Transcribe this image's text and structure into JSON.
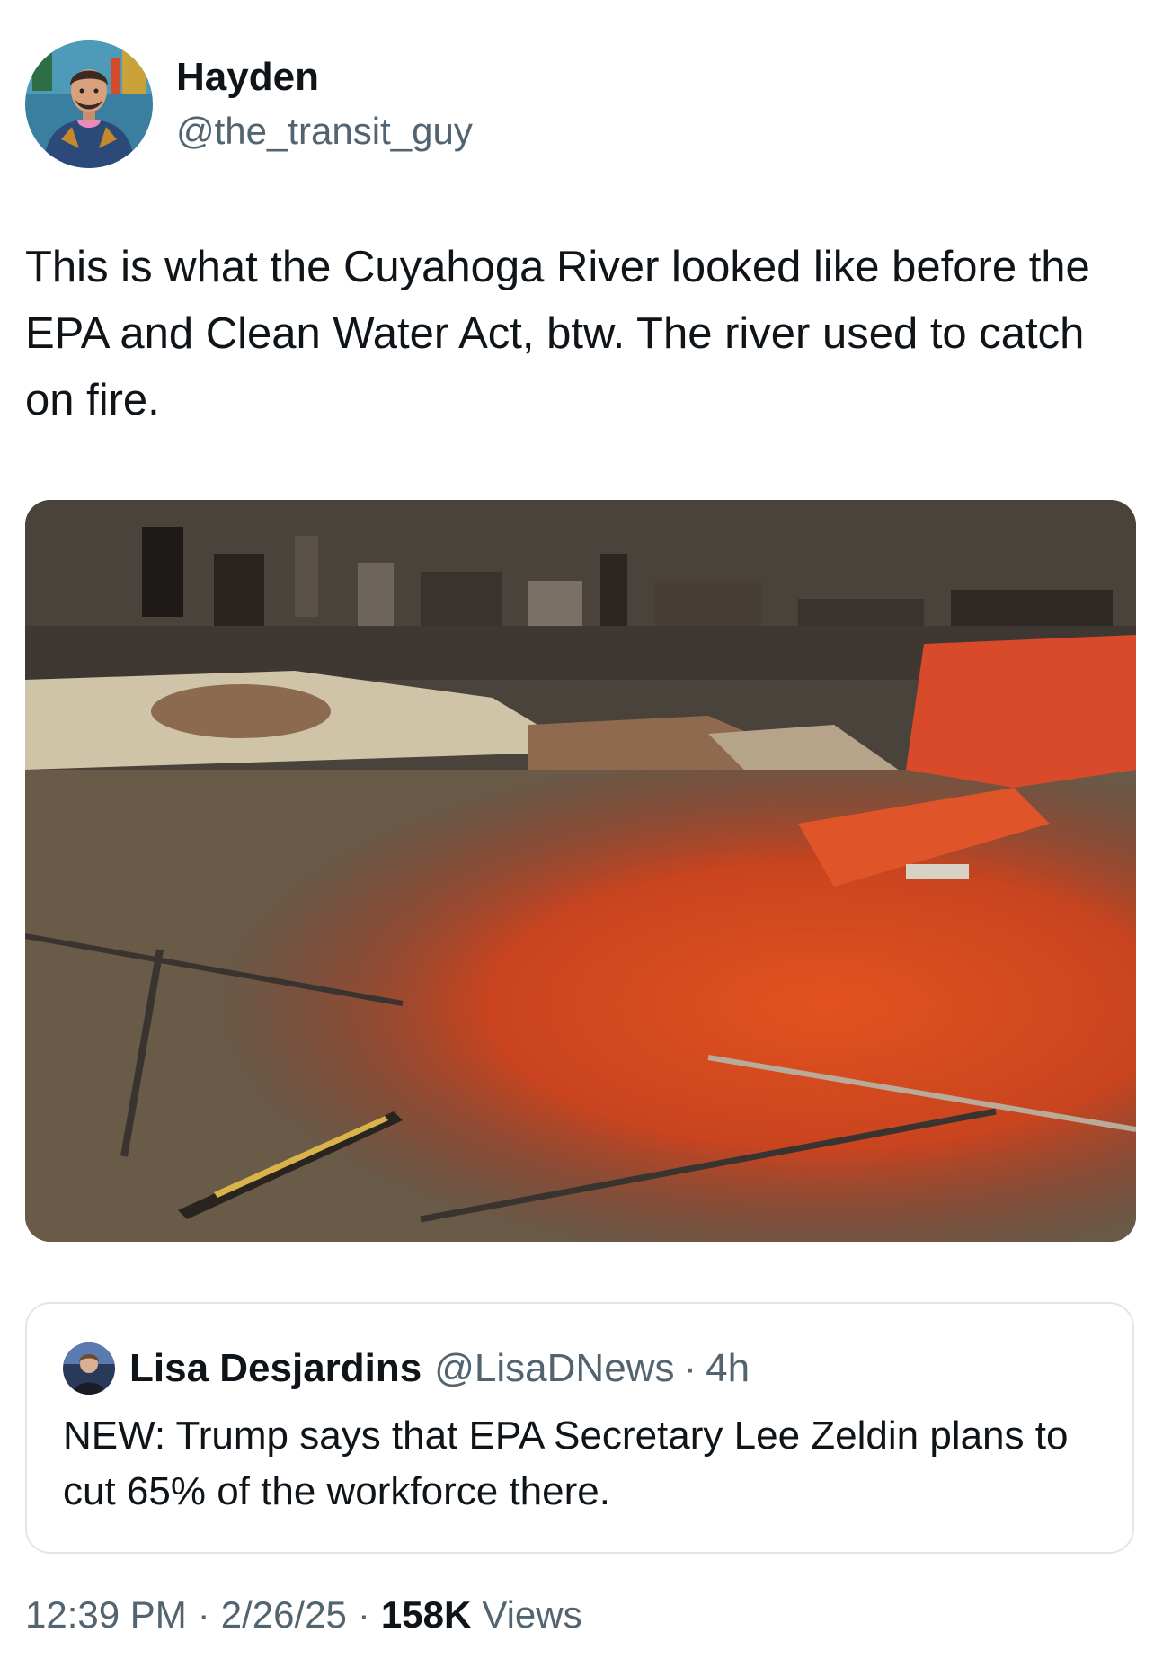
{
  "tweet": {
    "author": {
      "display_name": "Hayden",
      "handle": "@the_transit_guy",
      "avatar_icon": "cartoon-avatar-icon"
    },
    "text": "This is what the Cuyahoga River looked like before the EPA and Clean Water Act, btw. The river used to catch on fire.",
    "media": {
      "type": "photo",
      "subject": "aerial-river-harbor-photo"
    },
    "quote": {
      "display_name": "Lisa Desjardins",
      "handle": "@LisaDNews",
      "separator": "·",
      "time": "4h",
      "text": "NEW: Trump says that EPA Secretary Lee Zeldin plans to cut 65% of the workforce there."
    },
    "meta": {
      "time": "12:39 PM",
      "separator": "·",
      "date": "2/26/25",
      "views_count": "158K",
      "views_label": "Views"
    }
  },
  "colors": {
    "text_primary": "#0f1419",
    "text_secondary": "#536471",
    "border": "#e1e6ea",
    "river_red": "#d4471f"
  }
}
